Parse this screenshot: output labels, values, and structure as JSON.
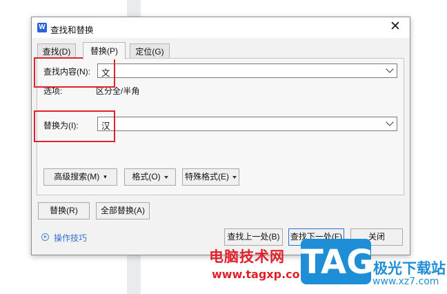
{
  "dialog": {
    "title": "查找和替换",
    "app_icon_letter": "W",
    "close_glyph": "✕"
  },
  "tabs": [
    {
      "label": "查找(D)"
    },
    {
      "label": "替换(P)",
      "active": true
    },
    {
      "label": "定位(G)"
    }
  ],
  "find": {
    "label": "查找内容(N):",
    "value": "文"
  },
  "options": {
    "label": "选项:",
    "value": "区分全/半角"
  },
  "replace": {
    "label": "替换为(I):",
    "value": "汉"
  },
  "format_buttons": {
    "advanced_search": "高级搜索(M)",
    "format": "格式(O)",
    "special_format": "特殊格式(E)"
  },
  "actions": {
    "replace": "替换(R)",
    "replace_all": "全部替换(A)",
    "find_prev": "查找上一处(B)",
    "find_next": "查找下一处(F)",
    "close": "关闭"
  },
  "tips": {
    "label": "操作技巧"
  },
  "watermark": {
    "cn_title": "电脑技术网",
    "url": "www.tagxp.com",
    "logo_text": "TAG",
    "site_cn": "极光下载站",
    "site_url": "www.xz7.com"
  },
  "colors": {
    "highlight": "#e0202a",
    "accent": "#2f6fd0",
    "logo": "#1e8fd6"
  }
}
